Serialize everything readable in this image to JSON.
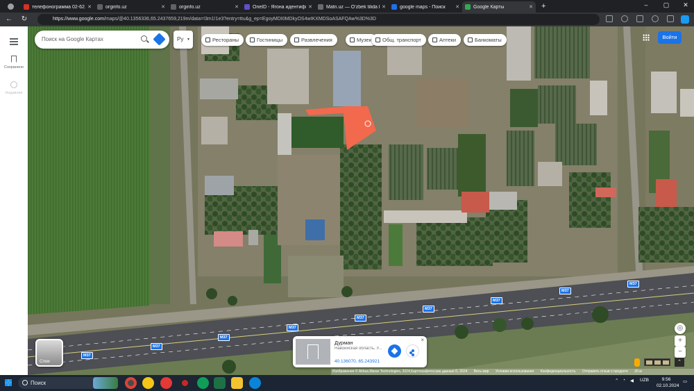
{
  "browser": {
    "tabs": [
      {
        "title": "телефонограмма 02-62.PDF",
        "color": "#d93025",
        "active": false
      },
      {
        "title": "orginfo.uz",
        "color": "#5f6368",
        "active": false
      },
      {
        "title": "orginfo.uz",
        "color": "#5f6368",
        "active": false
      },
      {
        "title": "OneID - Ягона идентификаци",
        "color": "#5e4fcf",
        "active": false
      },
      {
        "title": "Matn.uz — O‘zbek tilida bexato",
        "color": "#6b6b6b",
        "active": false
      },
      {
        "title": "google maps - Поиск",
        "color": "#1f6feb",
        "active": false
      },
      {
        "title": "Google Карты",
        "color": "#34a853",
        "active": true
      }
    ],
    "url_host": "https://www.google.com",
    "url_path": "/maps/@40.1356336,65.2437659,219m/data=!3m1!1e3?entry=ttu&g_ep=EgoyMDI0MDkyOS4wIKXMDSoASAFQAw%3D%3D"
  },
  "maps": {
    "rail": {
      "saved_label": "Сохранено",
      "recent_label": "Недавние"
    },
    "search_placeholder": "Поиск на Google Картах",
    "lang_label": "Ру",
    "chips": [
      {
        "label": "Рестораны",
        "icon": "fork-knife-icon"
      },
      {
        "label": "Гостиницы",
        "icon": "bed-icon"
      },
      {
        "label": "Развлечения",
        "icon": "ticket-icon"
      },
      {
        "label": "Музеи",
        "icon": "museum-icon"
      },
      {
        "label": "Общ. транспорт",
        "icon": "bus-icon"
      },
      {
        "label": "Аптеки",
        "icon": "pharmacy-icon"
      },
      {
        "label": "Банкоматы",
        "icon": "atm-icon"
      }
    ],
    "signin_label": "Войти",
    "road_label": "M37",
    "layers_label": "Слои",
    "place_card": {
      "name": "Дурман",
      "address": "Навоийская область, У...",
      "coords": "40.136070, 65.243921",
      "close": "×"
    },
    "zoom_in": "+",
    "zoom_out": "−",
    "attribution": {
      "imagery": "Изображения © Airbus,Maxar Technologies, 2024,Картографические данные ©, 2024",
      "country": "Весь мир",
      "terms": "Условия использования",
      "privacy": "Конфиденциальность",
      "feedback": "Отправить отзыв о продукте",
      "scale": "20 м"
    }
  },
  "taskbar": {
    "search_label": "Поиск",
    "lang": "UZB",
    "time": "9:56",
    "date": "02.10.2024"
  }
}
